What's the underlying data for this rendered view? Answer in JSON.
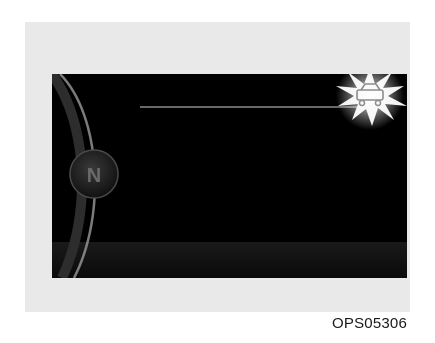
{
  "figure": {
    "caption": "OPS05306",
    "screen": {
      "gear_indicator_icon": "gear-n-icon",
      "warning_icon": "vehicle-warning-icon",
      "warning_state": "flashing"
    }
  },
  "colors": {
    "page_background": "#ffffff",
    "panel_background": "#e9e9e9",
    "screen_background": "#000000",
    "burst": "#ffffff"
  }
}
